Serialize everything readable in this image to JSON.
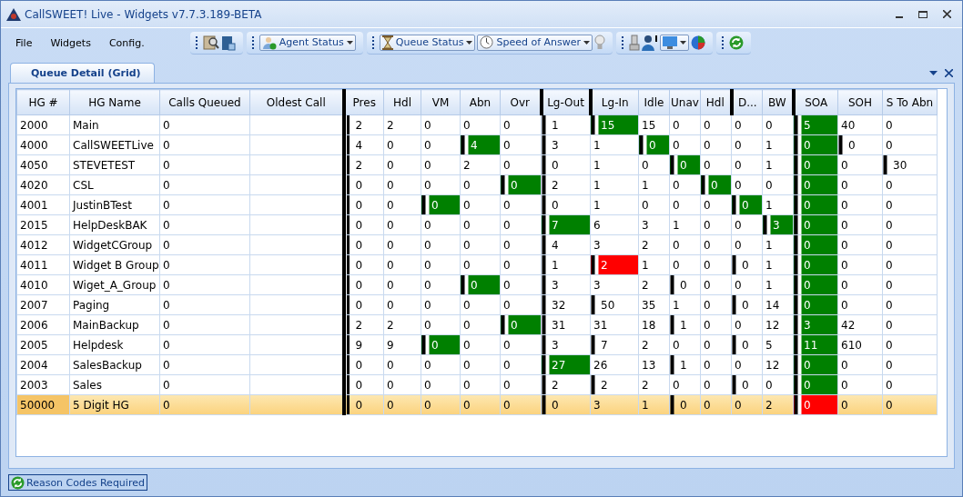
{
  "window": {
    "title": "CallSWEET! Live - Widgets v7.7.3.189-BETA"
  },
  "menu": [
    "File",
    "Widgets",
    "Config."
  ],
  "toolbar": {
    "dropdowns": [
      "Agent Status",
      "Queue Status",
      "Speed of Answer"
    ]
  },
  "tabs": [
    {
      "label": "Queue Detail (Grid)",
      "selected": true
    }
  ],
  "table": {
    "columns": [
      {
        "label": "HG #"
      },
      {
        "label": "HG Name"
      },
      {
        "label": "Calls Queued"
      },
      {
        "label": "Oldest Call"
      },
      {
        "label": "Pres",
        "divider": true
      },
      {
        "label": "Hdl"
      },
      {
        "label": "VM"
      },
      {
        "label": "Abn"
      },
      {
        "label": "Ovr"
      },
      {
        "label": "Lg-Out",
        "divider": true
      },
      {
        "label": "Lg-In",
        "divider": true
      },
      {
        "label": "Idle"
      },
      {
        "label": "Unav"
      },
      {
        "label": "Hdl"
      },
      {
        "label": "D...",
        "divider": true
      },
      {
        "label": "BW"
      },
      {
        "label": "SOA",
        "divider": true
      },
      {
        "label": "SOH"
      },
      {
        "label": "S To Abn"
      }
    ],
    "rows": [
      {
        "selected": false,
        "cells": [
          {
            "v": "2000"
          },
          {
            "v": "Main"
          },
          {
            "v": "0"
          },
          {},
          {
            "v": "2",
            "kind": "marker"
          },
          {
            "v": "2"
          },
          {
            "v": "0"
          },
          {
            "v": "0"
          },
          {
            "v": "0"
          },
          {
            "v": "1",
            "kind": "marker"
          },
          {
            "v": "15",
            "kind": "fill",
            "color": "#008000"
          },
          {
            "v": "15"
          },
          {
            "v": "0"
          },
          {
            "v": "0"
          },
          {
            "v": "0"
          },
          {
            "v": "0"
          },
          {
            "v": "5",
            "kind": "fill",
            "color": "#008000"
          },
          {
            "v": "40"
          },
          {
            "v": "0"
          }
        ]
      },
      {
        "selected": false,
        "cells": [
          {
            "v": "4000"
          },
          {
            "v": "CallSWEETLive"
          },
          {
            "v": "0"
          },
          {},
          {
            "v": "4",
            "kind": "marker"
          },
          {
            "v": "0"
          },
          {
            "v": "0"
          },
          {
            "v": "4",
            "kind": "fill",
            "color": "#008000"
          },
          {
            "v": "0"
          },
          {
            "v": "3",
            "kind": "marker"
          },
          {
            "v": "1"
          },
          {
            "v": "0",
            "kind": "fill",
            "color": "#008000"
          },
          {
            "v": "0"
          },
          {
            "v": "0"
          },
          {
            "v": "0"
          },
          {
            "v": "1"
          },
          {
            "v": "0",
            "kind": "fill",
            "color": "#008000"
          },
          {
            "v": "0",
            "kind": "marker"
          },
          {
            "v": "0"
          }
        ]
      },
      {
        "selected": false,
        "cells": [
          {
            "v": "4050"
          },
          {
            "v": "STEVETEST"
          },
          {
            "v": "0"
          },
          {},
          {
            "v": "2",
            "kind": "marker"
          },
          {
            "v": "0"
          },
          {
            "v": "0"
          },
          {
            "v": "2"
          },
          {
            "v": "0"
          },
          {
            "v": "0",
            "kind": "marker"
          },
          {
            "v": "1"
          },
          {
            "v": "0"
          },
          {
            "v": "0",
            "kind": "fill",
            "color": "#008000"
          },
          {
            "v": "0"
          },
          {
            "v": "0"
          },
          {
            "v": "1"
          },
          {
            "v": "0",
            "kind": "fill",
            "color": "#008000"
          },
          {
            "v": "0"
          },
          {
            "v": "30",
            "kind": "marker"
          }
        ]
      },
      {
        "selected": false,
        "cells": [
          {
            "v": "4020"
          },
          {
            "v": "CSL"
          },
          {
            "v": "0"
          },
          {},
          {
            "v": "0",
            "kind": "marker"
          },
          {
            "v": "0"
          },
          {
            "v": "0"
          },
          {
            "v": "0"
          },
          {
            "v": "0",
            "kind": "fill",
            "color": "#008000"
          },
          {
            "v": "2",
            "kind": "marker"
          },
          {
            "v": "1"
          },
          {
            "v": "1"
          },
          {
            "v": "0"
          },
          {
            "v": "0",
            "kind": "fill",
            "color": "#008000"
          },
          {
            "v": "0"
          },
          {
            "v": "0"
          },
          {
            "v": "0",
            "kind": "fill",
            "color": "#008000"
          },
          {
            "v": "0"
          },
          {
            "v": "0"
          }
        ]
      },
      {
        "selected": false,
        "cells": [
          {
            "v": "4001"
          },
          {
            "v": "JustinBTest"
          },
          {
            "v": "0"
          },
          {},
          {
            "v": "0",
            "kind": "marker"
          },
          {
            "v": "0"
          },
          {
            "v": "0",
            "kind": "fill",
            "color": "#008000"
          },
          {
            "v": "0"
          },
          {
            "v": "0"
          },
          {
            "v": "0",
            "kind": "marker"
          },
          {
            "v": "1"
          },
          {
            "v": "0"
          },
          {
            "v": "0"
          },
          {
            "v": "0"
          },
          {
            "v": "0",
            "kind": "fill",
            "color": "#008000"
          },
          {
            "v": "1"
          },
          {
            "v": "0",
            "kind": "fill",
            "color": "#008000"
          },
          {
            "v": "0"
          },
          {
            "v": "0"
          }
        ]
      },
      {
        "selected": false,
        "cells": [
          {
            "v": "2015"
          },
          {
            "v": "HelpDeskBAK"
          },
          {
            "v": "0"
          },
          {},
          {
            "v": "0",
            "kind": "marker"
          },
          {
            "v": "0"
          },
          {
            "v": "0"
          },
          {
            "v": "0"
          },
          {
            "v": "0"
          },
          {
            "v": "7",
            "kind": "fill",
            "color": "#008000"
          },
          {
            "v": "6"
          },
          {
            "v": "3"
          },
          {
            "v": "1"
          },
          {
            "v": "0"
          },
          {
            "v": "0"
          },
          {
            "v": "3",
            "kind": "fill",
            "color": "#008000"
          },
          {
            "v": "0",
            "kind": "fill",
            "color": "#008000"
          },
          {
            "v": "0"
          },
          {
            "v": "0"
          }
        ]
      },
      {
        "selected": false,
        "cells": [
          {
            "v": "4012"
          },
          {
            "v": "WidgetCGroup"
          },
          {
            "v": "0"
          },
          {},
          {
            "v": "0",
            "kind": "marker"
          },
          {
            "v": "0"
          },
          {
            "v": "0"
          },
          {
            "v": "0"
          },
          {
            "v": "0"
          },
          {
            "v": "4",
            "kind": "marker"
          },
          {
            "v": "3"
          },
          {
            "v": "2"
          },
          {
            "v": "0"
          },
          {
            "v": "0"
          },
          {
            "v": "0"
          },
          {
            "v": "1"
          },
          {
            "v": "0",
            "kind": "fill",
            "color": "#008000"
          },
          {
            "v": "0"
          },
          {
            "v": "0"
          }
        ]
      },
      {
        "selected": false,
        "cells": [
          {
            "v": "4011"
          },
          {
            "v": "Widget B Group"
          },
          {
            "v": "0"
          },
          {},
          {
            "v": "0",
            "kind": "marker"
          },
          {
            "v": "0"
          },
          {
            "v": "0"
          },
          {
            "v": "0"
          },
          {
            "v": "0"
          },
          {
            "v": "1",
            "kind": "marker"
          },
          {
            "v": "2",
            "kind": "fill",
            "color": "#ff0000"
          },
          {
            "v": "1"
          },
          {
            "v": "0"
          },
          {
            "v": "0"
          },
          {
            "v": "0",
            "kind": "marker"
          },
          {
            "v": "1"
          },
          {
            "v": "0",
            "kind": "fill",
            "color": "#008000"
          },
          {
            "v": "0"
          },
          {
            "v": "0"
          }
        ]
      },
      {
        "selected": false,
        "cells": [
          {
            "v": "4010"
          },
          {
            "v": "Wiget_A_Group"
          },
          {
            "v": "0"
          },
          {},
          {
            "v": "0",
            "kind": "marker"
          },
          {
            "v": "0"
          },
          {
            "v": "0"
          },
          {
            "v": "0",
            "kind": "fill",
            "color": "#008000"
          },
          {
            "v": "0"
          },
          {
            "v": "3",
            "kind": "marker"
          },
          {
            "v": "3"
          },
          {
            "v": "2"
          },
          {
            "v": "0",
            "kind": "marker"
          },
          {
            "v": "0"
          },
          {
            "v": "0"
          },
          {
            "v": "1"
          },
          {
            "v": "0",
            "kind": "fill",
            "color": "#008000"
          },
          {
            "v": "0"
          },
          {
            "v": "0"
          }
        ]
      },
      {
        "selected": false,
        "cells": [
          {
            "v": "2007"
          },
          {
            "v": "Paging"
          },
          {
            "v": "0"
          },
          {},
          {
            "v": "0",
            "kind": "marker"
          },
          {
            "v": "0"
          },
          {
            "v": "0"
          },
          {
            "v": "0"
          },
          {
            "v": "0"
          },
          {
            "v": "32",
            "kind": "marker"
          },
          {
            "v": "50",
            "kind": "marker"
          },
          {
            "v": "35"
          },
          {
            "v": "1"
          },
          {
            "v": "0"
          },
          {
            "v": "0",
            "kind": "marker"
          },
          {
            "v": "14"
          },
          {
            "v": "0",
            "kind": "fill",
            "color": "#008000"
          },
          {
            "v": "0"
          },
          {
            "v": "0"
          }
        ]
      },
      {
        "selected": false,
        "cells": [
          {
            "v": "2006"
          },
          {
            "v": "MainBackup"
          },
          {
            "v": "0"
          },
          {},
          {
            "v": "2",
            "kind": "marker"
          },
          {
            "v": "2"
          },
          {
            "v": "0"
          },
          {
            "v": "0"
          },
          {
            "v": "0",
            "kind": "fill",
            "color": "#008000"
          },
          {
            "v": "31",
            "kind": "marker"
          },
          {
            "v": "31"
          },
          {
            "v": "18"
          },
          {
            "v": "1",
            "kind": "marker"
          },
          {
            "v": "0"
          },
          {
            "v": "0"
          },
          {
            "v": "12"
          },
          {
            "v": "3",
            "kind": "fill",
            "color": "#008000"
          },
          {
            "v": "42"
          },
          {
            "v": "0"
          }
        ]
      },
      {
        "selected": false,
        "cells": [
          {
            "v": "2005"
          },
          {
            "v": "Helpdesk"
          },
          {
            "v": "0"
          },
          {},
          {
            "v": "9",
            "kind": "marker"
          },
          {
            "v": "9"
          },
          {
            "v": "0",
            "kind": "fill",
            "color": "#008000"
          },
          {
            "v": "0"
          },
          {
            "v": "0"
          },
          {
            "v": "3",
            "kind": "marker"
          },
          {
            "v": "7",
            "kind": "marker"
          },
          {
            "v": "2"
          },
          {
            "v": "0"
          },
          {
            "v": "0"
          },
          {
            "v": "0",
            "kind": "marker"
          },
          {
            "v": "5"
          },
          {
            "v": "11",
            "kind": "fill",
            "color": "#008000"
          },
          {
            "v": "610"
          },
          {
            "v": "0"
          }
        ]
      },
      {
        "selected": false,
        "cells": [
          {
            "v": "2004"
          },
          {
            "v": "SalesBackup"
          },
          {
            "v": "0"
          },
          {},
          {
            "v": "0",
            "kind": "marker"
          },
          {
            "v": "0"
          },
          {
            "v": "0"
          },
          {
            "v": "0"
          },
          {
            "v": "0"
          },
          {
            "v": "27",
            "kind": "fill",
            "color": "#008000"
          },
          {
            "v": "26"
          },
          {
            "v": "13"
          },
          {
            "v": "1",
            "kind": "marker"
          },
          {
            "v": "0"
          },
          {
            "v": "0"
          },
          {
            "v": "12"
          },
          {
            "v": "0",
            "kind": "fill",
            "color": "#008000"
          },
          {
            "v": "0"
          },
          {
            "v": "0"
          }
        ]
      },
      {
        "selected": false,
        "cells": [
          {
            "v": "2003"
          },
          {
            "v": "Sales"
          },
          {
            "v": "0"
          },
          {},
          {
            "v": "0",
            "kind": "marker"
          },
          {
            "v": "0"
          },
          {
            "v": "0"
          },
          {
            "v": "0"
          },
          {
            "v": "0"
          },
          {
            "v": "2",
            "kind": "marker"
          },
          {
            "v": "2",
            "kind": "marker"
          },
          {
            "v": "2"
          },
          {
            "v": "0"
          },
          {
            "v": "0"
          },
          {
            "v": "0",
            "kind": "marker"
          },
          {
            "v": "0"
          },
          {
            "v": "0",
            "kind": "fill",
            "color": "#008000"
          },
          {
            "v": "0"
          },
          {
            "v": "0"
          }
        ]
      },
      {
        "selected": true,
        "cells": [
          {
            "v": "50000"
          },
          {
            "v": "5 Digit HG"
          },
          {
            "v": "0"
          },
          {},
          {
            "v": "0",
            "kind": "marker"
          },
          {
            "v": "0"
          },
          {
            "v": "0"
          },
          {
            "v": "0"
          },
          {
            "v": "0"
          },
          {
            "v": "0",
            "kind": "marker"
          },
          {
            "v": "3"
          },
          {
            "v": "1"
          },
          {
            "v": "0",
            "kind": "marker"
          },
          {
            "v": "0"
          },
          {
            "v": "0"
          },
          {
            "v": "2"
          },
          {
            "v": "0",
            "kind": "fill",
            "color": "#ff0000"
          },
          {
            "v": "0"
          },
          {
            "v": "0"
          }
        ]
      }
    ]
  },
  "status_bar": {
    "label": "Reason Codes Required"
  }
}
